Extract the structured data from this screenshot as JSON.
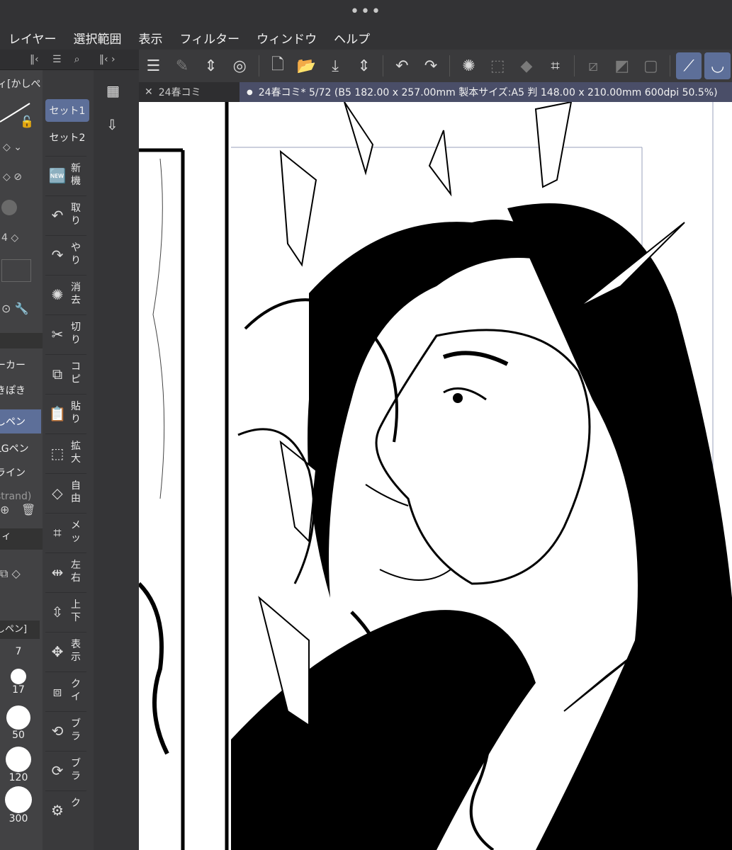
{
  "window": {
    "dots": "•••"
  },
  "menu": [
    "レイヤー",
    "選択範囲",
    "表示",
    "フィルター",
    "ウィンドウ",
    "ヘルプ"
  ],
  "left_panel": {
    "subtool_header": "ィ[かしぺ",
    "subtools": [
      "ーカー",
      "きぽき",
      "しペン",
      "LGペン",
      "ライン",
      "strand)"
    ],
    "property_tab": "ィ",
    "brush_name": "しペン]",
    "brush_sizes": [
      "7",
      "17",
      "50",
      "120",
      "300"
    ]
  },
  "tool_palette": {
    "sets": [
      "セット1",
      "セット2"
    ],
    "tools": [
      {
        "icon": "new-icon",
        "label": "新機"
      },
      {
        "icon": "undo-icon",
        "label": "取り"
      },
      {
        "icon": "redo-icon",
        "label": "やり"
      },
      {
        "icon": "erase-icon",
        "label": "消去"
      },
      {
        "icon": "cut-icon",
        "label": "切り"
      },
      {
        "icon": "copy-icon",
        "label": "コピ"
      },
      {
        "icon": "paste-icon",
        "label": "貼り"
      },
      {
        "icon": "scale-icon",
        "label": "拡大"
      },
      {
        "icon": "free-transform-icon",
        "label": "自由"
      },
      {
        "icon": "mesh-icon",
        "label": "メッ"
      },
      {
        "icon": "flip-horizontal-icon",
        "label": "左右"
      },
      {
        "icon": "flip-vertical-icon",
        "label": "上下"
      },
      {
        "icon": "display-icon",
        "label": "表示"
      },
      {
        "icon": "quick-icon",
        "label": "クイ"
      },
      {
        "icon": "brush-icon-1",
        "label": "ブラ"
      },
      {
        "icon": "brush-icon-2",
        "label": "ブラ"
      },
      {
        "icon": "extra-icon",
        "label": "ク"
      }
    ]
  },
  "tabs": {
    "inactive": "24春コミ",
    "active": "24春コミ* 5/72 (B5 182.00 x 257.00mm 製本サイズ:A5 判 148.00 x 210.00mm 600dpi 50.5%)"
  }
}
